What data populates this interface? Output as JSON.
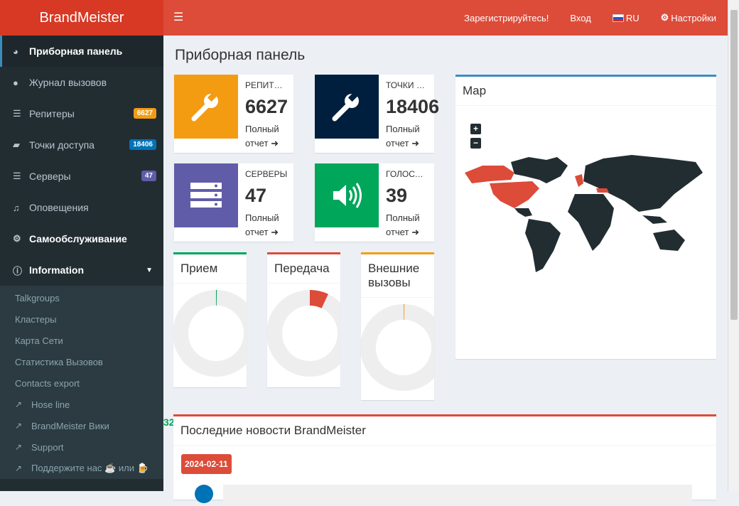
{
  "header": {
    "brand": "BrandMeister",
    "register": "Зарегистрируйтесь!",
    "login": "Вход",
    "language": "RU",
    "settings": "Настройки"
  },
  "sidebar": {
    "items": [
      {
        "label": "Приборная панель",
        "icon": "dashboard-icon"
      },
      {
        "label": "Журнал вызовов",
        "icon": "user-icon"
      },
      {
        "label": "Репитеры",
        "icon": "server-icon",
        "badge": "6627",
        "badge_color": "#f39c12"
      },
      {
        "label": "Точки доступа",
        "icon": "briefcase-icon",
        "badge": "18406",
        "badge_color": "#0073b7"
      },
      {
        "label": "Серверы",
        "icon": "server-icon",
        "badge": "47",
        "badge_color": "#605ca8"
      },
      {
        "label": "Оповещения",
        "icon": "bell-icon"
      },
      {
        "label": "Самообслуживание",
        "icon": "gear-icon"
      },
      {
        "label": "Information",
        "icon": "info-icon"
      }
    ],
    "submenu": [
      "Talkgroups",
      "Кластеры",
      "Карта Сети",
      "Статистика Вызовов",
      "Contacts export"
    ],
    "links": [
      "Hose line",
      "BrandMeister Вики",
      "Support",
      "Поддержите нас ☕ или 🍺"
    ]
  },
  "page_title": "Приборная панель",
  "info_boxes": [
    {
      "title": "РЕПИТЕРЫ",
      "value": "6627",
      "link": "Полный отчет",
      "color": "#f39c12"
    },
    {
      "title": "ТОЧКИ ДОСТУПА",
      "value": "18406",
      "link": "Полный отчет",
      "color": "#001f3f"
    },
    {
      "title": "СЕРВЕРЫ",
      "value": "47",
      "link": "Полный отчет",
      "color": "#605ca8"
    },
    {
      "title": "ГОЛОСОВЫЕ",
      "value": "39",
      "link": "Полный отчет",
      "color": "#00a65a"
    }
  ],
  "donuts": [
    {
      "title": "Прием",
      "color": "#00a65a",
      "fraction": 0.0
    },
    {
      "title": "Передача",
      "color": "#dd4b39",
      "fraction": 0.07
    },
    {
      "title": "Внешние вызовы",
      "color": "#f39c12",
      "fraction": 0.0
    }
  ],
  "map": {
    "title": "Map",
    "zoom_in": "+",
    "zoom_out": "−"
  },
  "news": {
    "title": "Последние новости BrandMeister",
    "date": "2024-02-11"
  },
  "stray_text": "32"
}
